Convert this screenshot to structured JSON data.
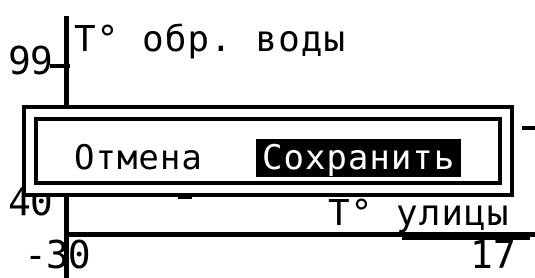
{
  "graph": {
    "title": "Т° обр. воды",
    "y_max": "99",
    "y_min": "40",
    "x_label": "Т° улицы",
    "x_min": "-30",
    "x_max": "17"
  },
  "dialog": {
    "cancel_label": "Отмена",
    "save_label": "Сохранить"
  },
  "colors": {
    "background": "#ffffff",
    "foreground": "#000000",
    "selected_background": "#000000",
    "selected_foreground": "#ffffff"
  }
}
